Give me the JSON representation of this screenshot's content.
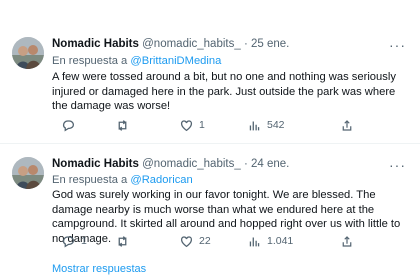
{
  "tweets": [
    {
      "name": "Nomadic Habits",
      "handle": "@nomadic_habits_",
      "dot": "·",
      "date": "25 ene.",
      "reply_prefix": "En respuesta a",
      "reply_to": "@BrittaniDMedina",
      "text": "A few were tossed around a bit, but no one and nothing was seriously injured or damaged here in the park. Just outside the park was where the damage was worse!",
      "replies": "",
      "retweets": "",
      "likes": "1",
      "views": "542"
    },
    {
      "name": "Nomadic Habits",
      "handle": "@nomadic_habits_",
      "dot": "·",
      "date": "24 ene.",
      "reply_prefix": "En respuesta a",
      "reply_to": "@Radorican",
      "text": "God was surely working in our favor tonight. We are blessed. The damage nearby is much worse than what we endured here at the campground. It skirted all around and hopped right over us with little to no damage.",
      "replies": "1",
      "retweets": "",
      "likes": "22",
      "views": "1.041"
    }
  ],
  "more_label": "···",
  "show_replies": "Mostrar respuestas",
  "colors": {
    "accent": "#1d9bf0",
    "muted": "#536471",
    "text": "#0f1419",
    "border": "#eff3f4"
  },
  "icons": [
    "reply-icon",
    "retweet-icon",
    "like-icon",
    "views-icon",
    "share-icon",
    "more-icon"
  ]
}
